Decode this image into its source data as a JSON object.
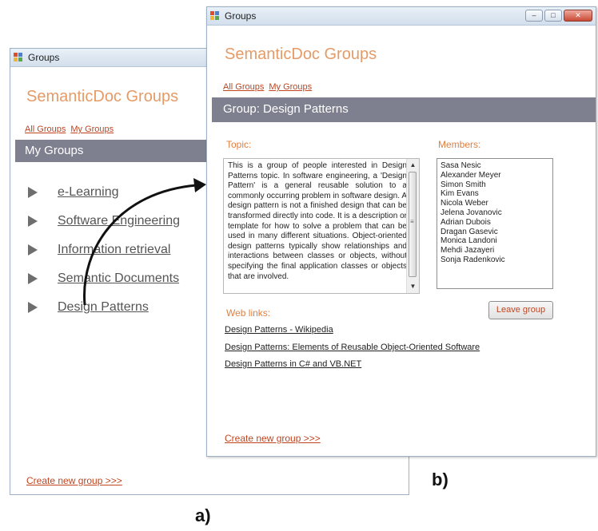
{
  "window_a": {
    "title": "Groups",
    "app_title": "SemanticDoc Groups",
    "links": [
      "All Groups",
      "My Groups"
    ],
    "header": "My Groups",
    "groups": [
      "e-Learning",
      "Software Engineering",
      "Information retrieval",
      "Semantic Documents",
      "Design Patterns"
    ],
    "create_link": "Create new group >>>",
    "caption": "a)"
  },
  "window_b": {
    "title": "Groups",
    "app_title": "SemanticDoc Groups",
    "links": [
      "All Groups",
      "My Groups"
    ],
    "header": "Group: Design Patterns",
    "topic_label": "Topic:",
    "topic_text": "This is a group of people interested in Design Patterns topic. In software engineering, a 'Design Pattern' is a general reusable solution to a commonly occurring problem in software design. A design pattern is not a finished design that can be transformed directly into code. It is a description or template for how to solve a problem that can be used in many different situations. Object-oriented design patterns typically show relationships and interactions between classes or objects, without specifying the final application classes or objects that are involved.",
    "members_label": "Members:",
    "members": [
      "Sasa Nesic",
      "Alexander Meyer",
      "Simon Smith",
      "Kim Evans",
      "Nicola Weber",
      "Jelena Jovanovic",
      "Adrian Dubois",
      "Dragan Gasevic",
      "Monica Landoni",
      "Mehdi Jazayeri",
      "Sonja Radenkovic"
    ],
    "leave_button": "Leave group",
    "weblinks_label": "Web links:",
    "weblinks": [
      "Design Patterns - Wikipedia",
      "Design Patterns: Elements of Reusable Object-Oriented Software",
      "Design Patterns in C# and VB.NET"
    ],
    "create_link": "Create new group >>>",
    "caption": "b)"
  },
  "colors": {
    "accent": "#e59b67",
    "link": "#c0451f",
    "header_band": "#7e7f8f"
  },
  "icons": {
    "app": "groups-app-icon",
    "list_bullet": "triangle-right-icon",
    "arrow": "curved-arrow-icon"
  }
}
